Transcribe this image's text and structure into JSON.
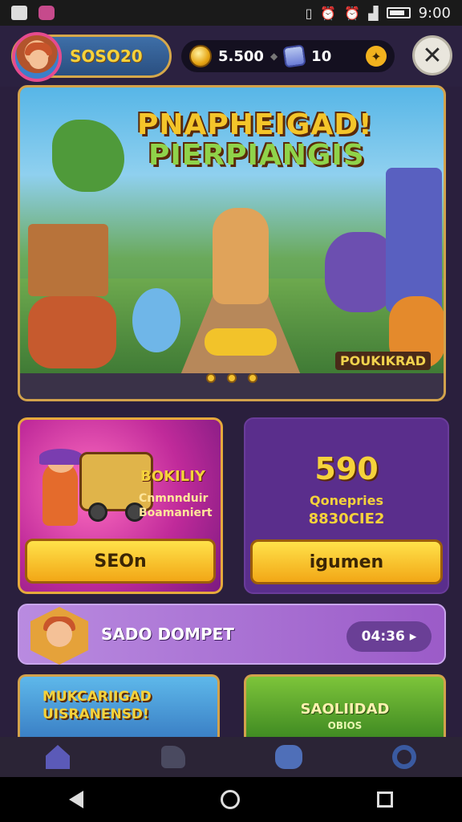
{
  "status_bar": {
    "time": "9:00"
  },
  "header": {
    "profile_name": "SOSO20",
    "coins": "5.500",
    "gems": "10"
  },
  "hero": {
    "title_line1": "PNAPHEIGAD!",
    "title_line2": "PIERPIANGIS",
    "badge": "POUKIKRAD"
  },
  "offers": {
    "left": {
      "title": "BOKILIY",
      "sub1": "Cnmnnduir",
      "sub2": "Boamaniert",
      "button": "SEOn"
    },
    "right": {
      "value": "590",
      "sub1": "Qonepries",
      "sub2": "8830CIE2",
      "button": "igumen"
    }
  },
  "promo": {
    "title": "SADO DOMPET",
    "timer": "04:36"
  },
  "bottom_cards": {
    "left_title_line1": "MUKCARIIGAD",
    "left_title_line2": "UISRANENSD!",
    "right_title": "SAOLIIDAD",
    "right_sub": "OBIOS"
  },
  "colors": {
    "accent_gold": "#f5d23b",
    "card_purple": "#5a2e8c",
    "background": "#2a1f3d"
  }
}
